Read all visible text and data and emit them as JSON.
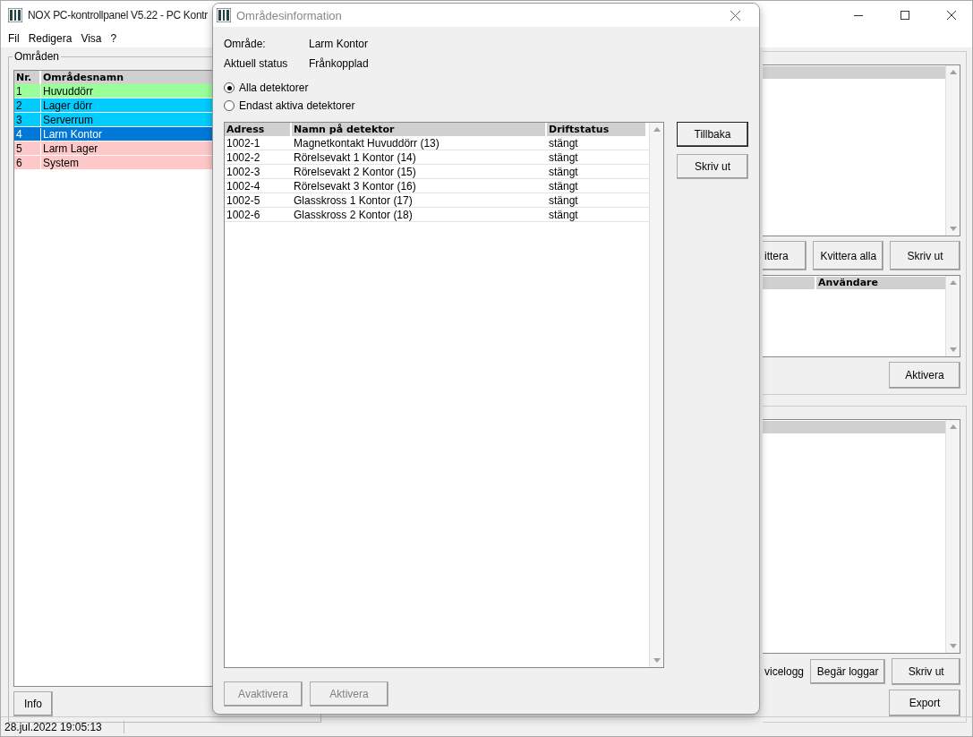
{
  "main_window": {
    "title": "NOX PC-kontrollpanel V5.22 - PC Kontr"
  },
  "menu": [
    "Fil",
    "Redigera",
    "Visa",
    "?"
  ],
  "areas": {
    "label": "Områden",
    "columns": [
      "Nr.",
      "Områdesnamn"
    ],
    "rows": [
      {
        "nr": "1",
        "name": "Huvuddörr",
        "color": "#99ff99",
        "selected": false
      },
      {
        "nr": "2",
        "name": "Lager dörr",
        "color": "#00ccff",
        "selected": false
      },
      {
        "nr": "3",
        "name": "Serverrum",
        "color": "#00ccff",
        "selected": false
      },
      {
        "nr": "4",
        "name": "Larm Kontor",
        "color": "#0078d7",
        "selected": true
      },
      {
        "nr": "5",
        "name": "Larm Lager",
        "color": "#ffc8c8",
        "selected": false
      },
      {
        "nr": "6",
        "name": "System",
        "color": "#ffc8c8",
        "selected": false
      }
    ],
    "info_button": "Info"
  },
  "alarm_panel": {
    "buttons": [
      "ittera",
      "Kvittera alla",
      "Skriv ut"
    ]
  },
  "user_panel": {
    "column": "Användare",
    "button": "Aktivera"
  },
  "log_panel": {
    "label": "vicelogg",
    "buttons": [
      "Begär loggar",
      "Skriv ut",
      "Export"
    ]
  },
  "status_bar": {
    "datetime": "28.jul.2022  19:05:13"
  },
  "dialog": {
    "title": "Områdesinformation",
    "fields": [
      {
        "label": "Område:",
        "value": "Larm Kontor"
      },
      {
        "label": "Aktuell status",
        "value": "Frånkopplad"
      }
    ],
    "filters": [
      {
        "label": "Alla detektorer",
        "selected": true
      },
      {
        "label": "Endast aktiva detektorer",
        "selected": false
      }
    ],
    "columns": [
      "Adress",
      "Namn på detektor",
      "Driftstatus"
    ],
    "rows": [
      {
        "address": "1002-1",
        "name": "Magnetkontakt Huvuddörr (13)",
        "status": "stängt"
      },
      {
        "address": "1002-2",
        "name": "Rörelsevakt 1 Kontor (14)",
        "status": "stängt"
      },
      {
        "address": "1002-3",
        "name": "Rörelsevakt 2 Kontor (15)",
        "status": "stängt"
      },
      {
        "address": "1002-4",
        "name": "Rörelsevakt 3 Kontor (16)",
        "status": "stängt"
      },
      {
        "address": "1002-5",
        "name": "Glasskross 1 Kontor (17)",
        "status": "stängt"
      },
      {
        "address": "1002-6",
        "name": "Glasskross 2 Kontor (18)",
        "status": "stängt"
      }
    ],
    "side_buttons": [
      {
        "label": "Tillbaka",
        "default": true
      },
      {
        "label": "Skriv ut",
        "default": false
      }
    ],
    "bottom_buttons": [
      {
        "label": "Avaktivera",
        "disabled": true
      },
      {
        "label": "Aktivera",
        "disabled": true
      }
    ]
  }
}
